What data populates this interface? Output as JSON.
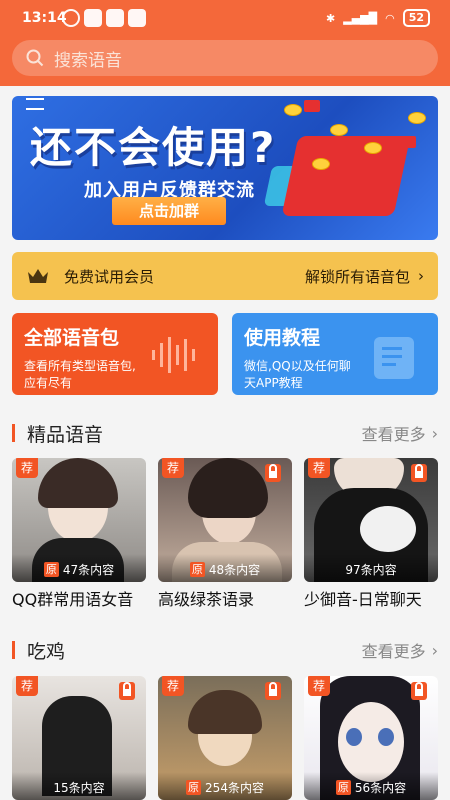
{
  "status": {
    "time": "13:14",
    "battery": "52"
  },
  "search": {
    "placeholder": "搜索语音"
  },
  "banner": {
    "title": "还不会使用?",
    "subtitle": "加入用户反馈群交流",
    "cta": "点击加群"
  },
  "vip": {
    "label": "免费试用会员",
    "action": "解锁所有语音包"
  },
  "cards": [
    {
      "title": "全部语音包",
      "desc": "查看所有类型语音包, 应有尽有"
    },
    {
      "title": "使用教程",
      "desc": "微信,QQ以及任何聊天APP教程"
    }
  ],
  "sections": [
    {
      "name": "精品语音",
      "more": "查看更多",
      "items": [
        {
          "tag": "荐",
          "orig": "原",
          "count": "47条内容",
          "caption": "QQ群常用语女音",
          "locked": false
        },
        {
          "tag": "荐",
          "orig": "原",
          "count": "48条内容",
          "caption": "高级绿茶语录",
          "locked": true
        },
        {
          "tag": "荐",
          "orig": "",
          "count": "97条内容",
          "caption": "少御音-日常聊天",
          "locked": true
        }
      ]
    },
    {
      "name": "吃鸡",
      "more": "查看更多",
      "items": [
        {
          "tag": "荐",
          "orig": "",
          "count": "15条内容",
          "caption": "",
          "locked": true
        },
        {
          "tag": "荐",
          "orig": "原",
          "count": "254条内容",
          "caption": "",
          "locked": true
        },
        {
          "tag": "荐",
          "orig": "原",
          "count": "56条内容",
          "caption": "",
          "locked": true
        }
      ]
    }
  ],
  "colors": {
    "accent": "#f4683a",
    "orange_card": "#f25524",
    "blue_card": "#3b93ef",
    "vip": "#f5c24f"
  }
}
